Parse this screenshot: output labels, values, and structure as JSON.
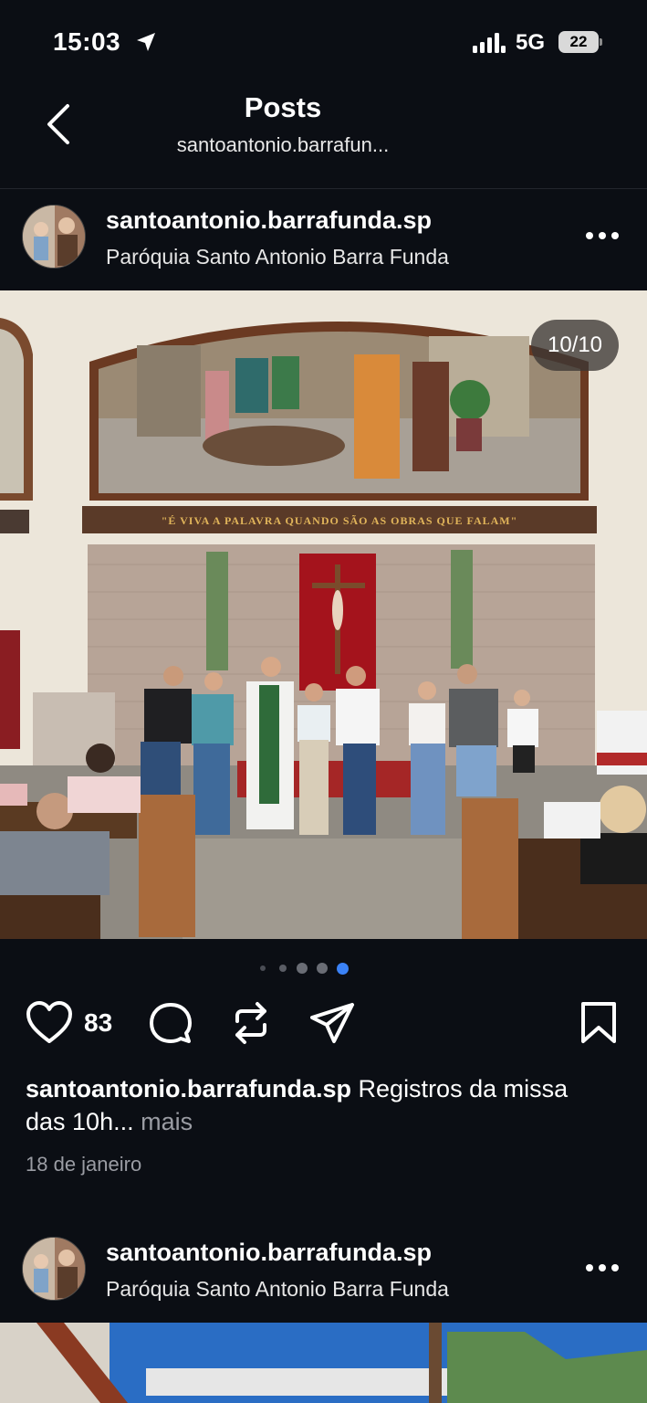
{
  "status": {
    "time": "15:03",
    "network": "5G",
    "battery": "22"
  },
  "header": {
    "title": "Posts",
    "subtitle": "santoantonio.barrafun..."
  },
  "posts": [
    {
      "username": "santoantonio.barrafunda.sp",
      "location": "Paróquia Santo Antonio Barra Funda",
      "counter": "10/10",
      "banner": "\"É VIVA A PALAVRA QUANDO SÃO AS OBRAS QUE FALAM\"",
      "likes": "83",
      "caption_user": "santoantonio.barrafunda.sp",
      "caption_text": " Registros da missa das 10h...",
      "caption_more": " mais",
      "date": "18 de janeiro",
      "carousel_active_index": 4,
      "carousel_count": 5
    },
    {
      "username": "santoantonio.barrafunda.sp",
      "location": "Paróquia Santo Antonio Barra Funda"
    }
  ],
  "icons": {
    "back": "chevron-left-icon",
    "more": "more-horizontal-icon",
    "like": "heart-icon",
    "comment": "comment-icon",
    "repost": "repost-icon",
    "share": "send-icon",
    "save": "bookmark-icon"
  },
  "colors": {
    "background": "#0b0e14",
    "accent_dot": "#3b82f6",
    "muted_text": "#9a9ca3"
  }
}
